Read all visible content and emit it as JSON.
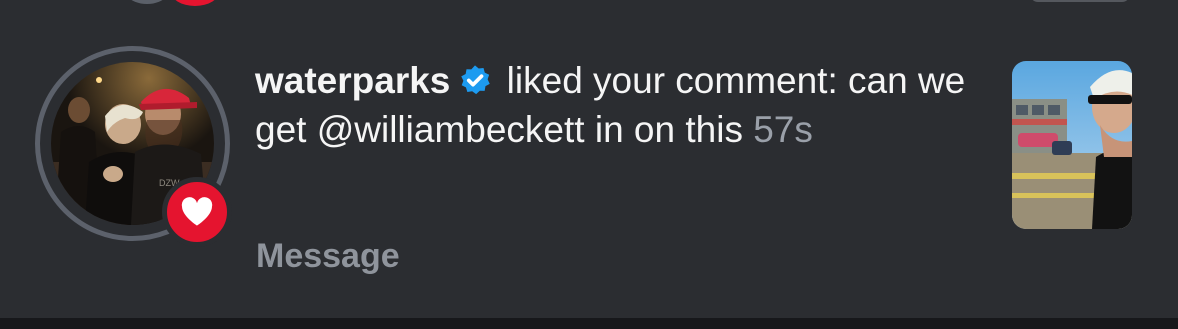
{
  "notification": {
    "username": "waterparks",
    "verified_icon": "verified-badge-icon",
    "action_text": " liked your comment:",
    "comment_text": " can we get @williambeckett in on this ",
    "timestamp": "57s",
    "reaction_icon": "heart-icon"
  },
  "actions": {
    "message_label": "Message"
  },
  "colors": {
    "background": "#2b2d31",
    "heart_badge": "#e5142f",
    "verified_blue": "#1d9bf0",
    "timestamp_grey": "#9aa0a9",
    "message_grey": "#8f949c"
  }
}
